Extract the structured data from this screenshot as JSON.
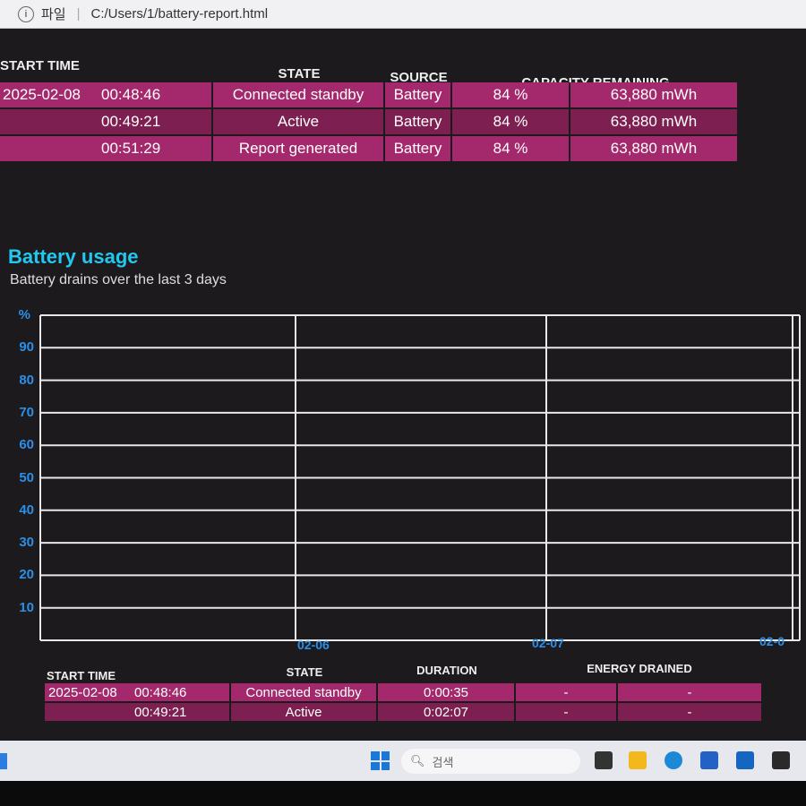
{
  "browser": {
    "page_info_label": "파일",
    "url": "C:/Users/1/battery-report.html"
  },
  "recent_usage": {
    "headers": [
      "START TIME",
      "STATE",
      "SOURCE",
      "CAPACITY REMAINING"
    ],
    "rows": [
      {
        "date": "2025-02-08",
        "time": "00:48:46",
        "state": "Connected standby",
        "source": "Battery",
        "percent": "84 %",
        "capacity": "63,880 mWh"
      },
      {
        "date": "",
        "time": "00:49:21",
        "state": "Active",
        "source": "Battery",
        "percent": "84 %",
        "capacity": "63,880 mWh"
      },
      {
        "date": "",
        "time": "00:51:29",
        "state": "Report generated",
        "source": "Battery",
        "percent": "84 %",
        "capacity": "63,880 mWh"
      }
    ]
  },
  "battery_usage": {
    "title": "Battery usage",
    "subtitle": "Battery drains over the last 3 days",
    "chart": {
      "y_unit": "%",
      "y_ticks": [
        "90",
        "80",
        "70",
        "60",
        "50",
        "40",
        "30",
        "20",
        "10"
      ],
      "x_ticks": [
        "02-06",
        "02-07",
        "02-0"
      ],
      "ylim": [
        0,
        100
      ],
      "series": []
    },
    "headers": [
      "START TIME",
      "STATE",
      "DURATION",
      "ENERGY DRAINED"
    ],
    "rows": [
      {
        "date": "2025-02-08",
        "time": "00:48:46",
        "state": "Connected standby",
        "duration": "0:00:35",
        "energy_pct": "-",
        "energy_mwh": "-"
      },
      {
        "date": "",
        "time": "00:49:21",
        "state": "Active",
        "duration": "0:02:07",
        "energy_pct": "-",
        "energy_mwh": "-"
      }
    ]
  },
  "taskbar": {
    "search_placeholder": "검색"
  },
  "colors": {
    "row_light": "#a3286c",
    "row_dark": "#7d1f50",
    "heading": "#23c8f0",
    "axis_label": "#2b8fe8"
  }
}
